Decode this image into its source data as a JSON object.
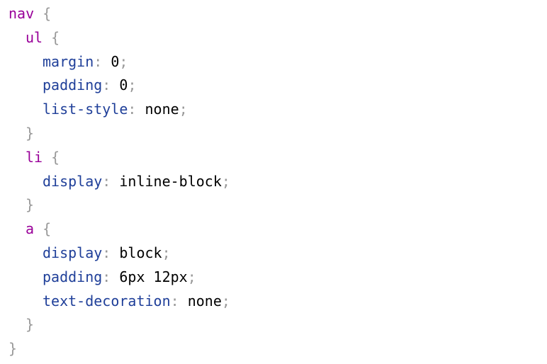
{
  "code": {
    "lines": [
      {
        "selector": "nav",
        "brace": "{"
      },
      {
        "selector": "ul",
        "brace": "{"
      },
      {
        "property": "margin",
        "colon": ":",
        "value": "0",
        "semi": ";"
      },
      {
        "property": "padding",
        "colon": ":",
        "value": "0",
        "semi": ";"
      },
      {
        "property": "list-style",
        "colon": ":",
        "value": "none",
        "semi": ";"
      },
      {
        "brace": "}"
      },
      {
        "selector": "li",
        "brace": "{"
      },
      {
        "property": "display",
        "colon": ":",
        "value": "inline-block",
        "semi": ";"
      },
      {
        "brace": "}"
      },
      {
        "selector": "a",
        "brace": "{"
      },
      {
        "property": "display",
        "colon": ":",
        "value": "block",
        "semi": ";"
      },
      {
        "property": "padding",
        "colon": ":",
        "value": "6px 12px",
        "semi": ";"
      },
      {
        "property": "text-decoration",
        "colon": ":",
        "value": "none",
        "semi": ";"
      },
      {
        "brace": "}"
      },
      {
        "brace": "}"
      }
    ]
  },
  "colors": {
    "selector": "#990099",
    "property": "#1f3f99",
    "punctuation": "#999999",
    "value": "#000000"
  }
}
